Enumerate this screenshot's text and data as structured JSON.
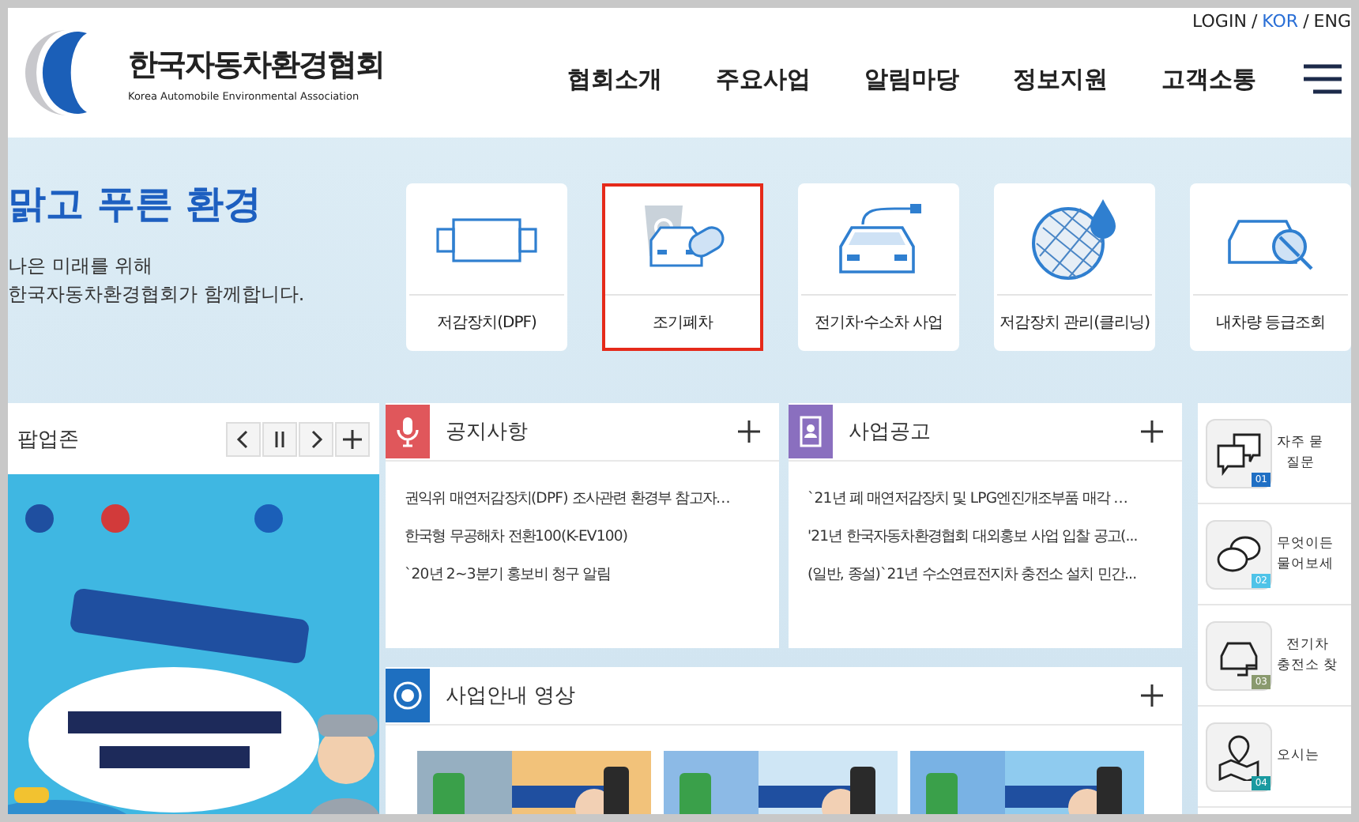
{
  "header": {
    "logo_title": "한국자동차환경협회",
    "logo_subtitle": "Korea Automobile Environmental Association",
    "language_separator": "/",
    "languages": [
      {
        "label": "LOGIN",
        "selected": false
      },
      {
        "label": "KOR",
        "selected": true
      },
      {
        "label": "ENG",
        "selected": false
      }
    ],
    "nav": [
      "협회소개",
      "주요사업",
      "알림마당",
      "정보지원",
      "고객소통"
    ]
  },
  "hero": {
    "title": "맑고 푸른 환경",
    "lines": [
      "나은 미래를 위해",
      "한국자동차환경협회가 함께합니다."
    ]
  },
  "services": [
    {
      "kind": "dpf",
      "label": "저감장치(DPF)",
      "selected": false
    },
    {
      "kind": "scrap",
      "label": "조기폐차",
      "selected": true
    },
    {
      "kind": "ev",
      "label": "전기차·수소차 사업",
      "selected": false
    },
    {
      "kind": "filter",
      "label": "저감장치 관리(클리닝)",
      "selected": false
    },
    {
      "kind": "search",
      "label": "내차량 등급조회",
      "selected": false
    }
  ],
  "popup_zone": {
    "title": "팝업존"
  },
  "notices": [
    {
      "kind": "notice",
      "title": "공지사항",
      "color": "#e0575b",
      "items": [
        "권익위 매연저감장치(DPF) 조사관련 환경부 참고자…",
        "한국형 무공해차 전환100(K-EV100)",
        "`20년 2~3분기 홍보비 청구 알림"
      ]
    },
    {
      "kind": "business",
      "title": "사업공고",
      "color": "#8a6fbf",
      "items": [
        "`21년 폐 매연저감장치 및 LPG엔진개조부품 매각 …",
        "'21년 한국자동차환경협회 대외홍보 사업 입찰 공고(...",
        "(일반, 종설)`21년 수소연료전지차 충전소 설치 민간..."
      ]
    }
  ],
  "video": {
    "title": "사업안내 영상",
    "color": "#1e6fc0"
  },
  "quick_links": [
    {
      "kind": "faq",
      "number": "01",
      "color": "#1f6fc4",
      "lines": [
        "자주 묻",
        "질문"
      ]
    },
    {
      "kind": "ask",
      "number": "02",
      "color": "#4fc3e8",
      "lines": [
        "무엇이든",
        "물어보세"
      ]
    },
    {
      "kind": "charger",
      "number": "03",
      "color": "#8a9a6e",
      "lines": [
        "전기차",
        "충전소 찾"
      ]
    },
    {
      "kind": "map",
      "number": "04",
      "color": "#1a9aa0",
      "lines": [
        "오시는"
      ]
    }
  ]
}
